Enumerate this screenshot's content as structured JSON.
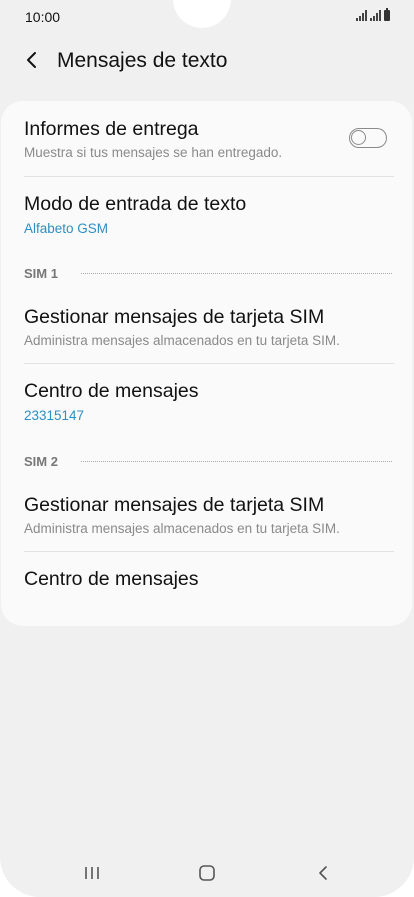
{
  "status_bar": {
    "time": "10:00",
    "icons": [
      "signal-sim1-icon",
      "signal-sim2-icon",
      "battery-icon"
    ]
  },
  "header": {
    "back_icon": "chevron-left-icon",
    "title": "Mensajes de texto"
  },
  "settings": {
    "delivery_reports": {
      "title": "Informes de entrega",
      "subtitle": "Muestra si tus mensajes se han entregado.",
      "toggle_on": false
    },
    "input_mode": {
      "title": "Modo de entrada de texto",
      "value": "Alfabeto GSM"
    },
    "sim1": {
      "label": "SIM 1",
      "manage": {
        "title": "Gestionar mensajes de tarjeta SIM",
        "subtitle": "Administra mensajes almacenados en tu tarjeta SIM."
      },
      "center": {
        "title": "Centro de mensajes",
        "value": "23315147"
      }
    },
    "sim2": {
      "label": "SIM 2",
      "manage": {
        "title": "Gestionar mensajes de tarjeta SIM",
        "subtitle": "Administra mensajes almacenados en tu tarjeta SIM."
      },
      "center": {
        "title": "Centro de mensajes"
      }
    }
  },
  "nav_bar": {
    "icons": [
      "recent-apps-icon",
      "home-icon",
      "back-icon"
    ]
  },
  "colors": {
    "accent": "#2f8ec2",
    "background": "#f0f0f0",
    "card": "#fafafa"
  }
}
